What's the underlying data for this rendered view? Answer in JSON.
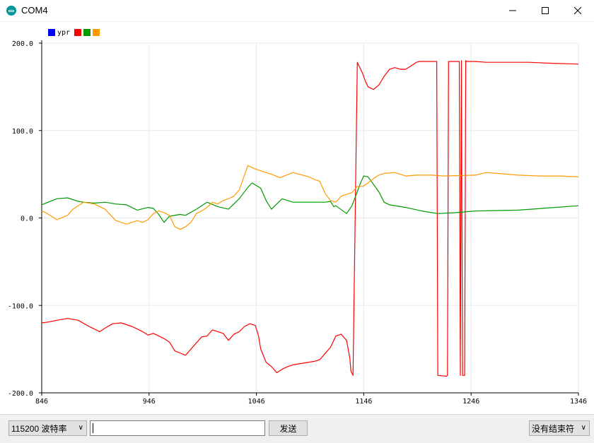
{
  "window": {
    "title": "COM4"
  },
  "chart_data": {
    "type": "line",
    "legend": {
      "label": "ypr",
      "placement": "top-left",
      "swatches": [
        "#0000ff",
        "#ff0000",
        "#009900",
        "#ff9900"
      ]
    },
    "xlim": [
      846,
      1346
    ],
    "ylim": [
      -200,
      200
    ],
    "x_ticks": [
      "846",
      "946",
      "1046",
      "1146",
      "1246",
      "1346"
    ],
    "y_ticks": [
      "200.0",
      "100.0",
      "0.0",
      "-100.0",
      "-200.0"
    ],
    "grid": true,
    "series": [
      {
        "color": "#ff0000",
        "x": [
          846,
          852,
          860,
          870,
          880,
          890,
          900,
          905,
          912,
          920,
          930,
          940,
          945,
          950,
          960,
          965,
          970,
          980,
          985,
          995,
          1000,
          1005,
          1010,
          1015,
          1020,
          1025,
          1030,
          1035,
          1040,
          1045,
          1048,
          1050,
          1055,
          1060,
          1065,
          1070,
          1075,
          1080,
          1090,
          1100,
          1105,
          1110,
          1115,
          1120,
          1125,
          1130,
          1133,
          1134,
          1136,
          1140,
          1145,
          1148,
          1150,
          1155,
          1160,
          1165,
          1170,
          1175,
          1180,
          1185,
          1190,
          1195,
          1198,
          1199,
          1205,
          1210,
          1214,
          1215,
          1223,
          1224,
          1225,
          1226,
          1235,
          1236,
          1237,
          1238,
          1240,
          1241,
          1242,
          1250,
          1260,
          1280,
          1300,
          1320,
          1346
        ],
        "y": [
          -120,
          -119,
          -117,
          -115,
          -117,
          -124,
          -130,
          -126,
          -121,
          -120,
          -124,
          -130,
          -134,
          -132,
          -138,
          -142,
          -152,
          -157,
          -150,
          -136,
          -135,
          -128,
          -130,
          -132,
          -140,
          -133,
          -130,
          -124,
          -121,
          -123,
          -135,
          -150,
          -165,
          -170,
          -177,
          -173,
          -170,
          -168,
          -166,
          -164,
          -162,
          -155,
          -148,
          -135,
          -133,
          -140,
          -160,
          -175,
          -180,
          178,
          165,
          155,
          150,
          147,
          152,
          162,
          170,
          172,
          170,
          170,
          174,
          178,
          179,
          179,
          179,
          179,
          179,
          -180,
          -181,
          -180,
          179,
          179,
          179,
          -180,
          180,
          -180,
          -180,
          180,
          179,
          179,
          178,
          178,
          178,
          177,
          176
        ]
      },
      {
        "color": "#009900",
        "x": [
          846,
          852,
          860,
          870,
          880,
          885,
          895,
          905,
          915,
          925,
          935,
          945,
          950,
          955,
          960,
          965,
          975,
          980,
          990,
          1000,
          1010,
          1020,
          1030,
          1038,
          1042,
          1050,
          1055,
          1060,
          1065,
          1070,
          1080,
          1090,
          1100,
          1110,
          1115,
          1118,
          1120,
          1130,
          1135,
          1140,
          1143,
          1146,
          1150,
          1160,
          1165,
          1170,
          1185,
          1200,
          1215,
          1230,
          1250,
          1290,
          1346
        ],
        "y": [
          15,
          18,
          22,
          23,
          19,
          18,
          17,
          18,
          16,
          15,
          9,
          12,
          11,
          4,
          -5,
          2,
          4,
          3,
          10,
          18,
          13,
          10,
          22,
          35,
          40,
          34,
          20,
          10,
          16,
          22,
          18,
          18,
          18,
          18,
          19,
          13,
          14,
          5,
          14,
          30,
          40,
          48,
          47,
          30,
          18,
          15,
          12,
          8,
          5,
          6,
          8,
          9,
          14
        ]
      },
      {
        "color": "#ff9900",
        "x": [
          846,
          850,
          860,
          870,
          875,
          885,
          895,
          905,
          915,
          920,
          925,
          935,
          940,
          945,
          950,
          955,
          960,
          965,
          970,
          975,
          980,
          985,
          990,
          995,
          1000,
          1005,
          1010,
          1015,
          1020,
          1025,
          1030,
          1038,
          1045,
          1050,
          1055,
          1060,
          1068,
          1080,
          1095,
          1100,
          1105,
          1110,
          1115,
          1120,
          1125,
          1130,
          1135,
          1140,
          1145,
          1150,
          1155,
          1160,
          1165,
          1175,
          1185,
          1195,
          1210,
          1220,
          1250,
          1260,
          1270,
          1290,
          1310,
          1330,
          1346
        ],
        "y": [
          8,
          6,
          -2,
          3,
          10,
          18,
          16,
          10,
          -3,
          -5,
          -7,
          -3,
          -5,
          -2,
          5,
          8,
          6,
          3,
          -10,
          -13,
          -10,
          -5,
          5,
          8,
          12,
          18,
          16,
          20,
          22,
          25,
          32,
          60,
          56,
          54,
          52,
          50,
          46,
          52,
          47,
          44,
          42,
          28,
          20,
          18,
          25,
          27,
          29,
          36,
          36,
          40,
          45,
          49,
          51,
          52,
          48,
          49,
          49,
          48,
          49,
          52,
          51,
          49,
          48,
          48,
          47
        ]
      },
      {
        "color": "#0000ff",
        "x": [],
        "y": []
      }
    ]
  },
  "bottom": {
    "baud": "115200  波特率",
    "input_value": "",
    "send_label": "发送",
    "line_ending": "没有结束符"
  }
}
